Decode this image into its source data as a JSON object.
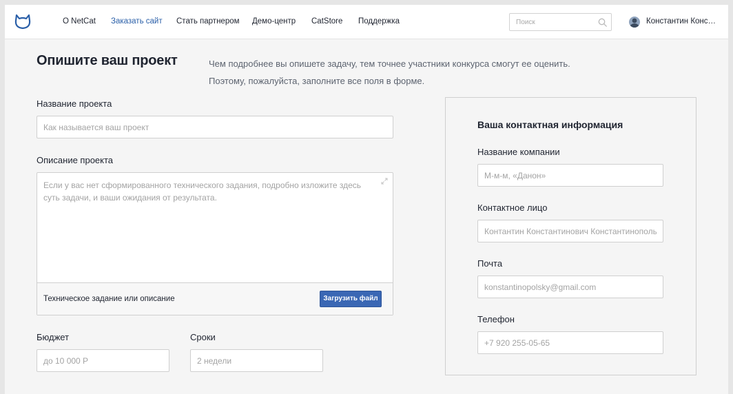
{
  "nav": {
    "items": [
      "О NetCat",
      "Заказать сайт",
      "Стать партнером",
      "Демо-центр",
      "CatStore",
      "Поддержка"
    ],
    "active_color": "#2a5fa8"
  },
  "search": {
    "placeholder": "Поиск",
    "icon": "search-icon"
  },
  "user": {
    "name": "Константин Константинопольский"
  },
  "page": {
    "title": "Опишите ваш проект",
    "intro_line1": "Чем подробнее вы опишете задачу, тем точнее участники конкурса смогут ее оценить.",
    "intro_line2": "Поэтому, пожалуйста, заполните все поля в форме."
  },
  "form": {
    "project_name": {
      "label": "Название проекта",
      "placeholder": "Как называется ваш проект"
    },
    "description": {
      "label": "Описание проекта",
      "placeholder": "Если у вас нет сформированного технического задания, подробно изложите здесь суть задачи, и ваши ожидания от результата.",
      "attachment_label": "Техническое задание или описание",
      "upload_button": "Загрузить файл"
    },
    "budget": {
      "label": "Бюджет",
      "placeholder": "до 10 000 Р"
    },
    "deadline": {
      "label": "Сроки",
      "placeholder": "2 недели"
    }
  },
  "contact": {
    "title": "Ваша контактная информация",
    "company": {
      "label": "Название компании",
      "placeholder": "М-м-м, «Данон»"
    },
    "person": {
      "label": "Контактное лицо",
      "placeholder": "Контантин Константинович Константинопольский"
    },
    "email": {
      "label": "Почта",
      "placeholder": "konstantinopolsky@gmail.com"
    },
    "phone": {
      "label": "Телефон",
      "placeholder": "+7 920 255-05-65"
    }
  },
  "colors": {
    "accent": "#3a67b4",
    "brand": "#2a5fa8",
    "background": "#f5f5f5"
  }
}
